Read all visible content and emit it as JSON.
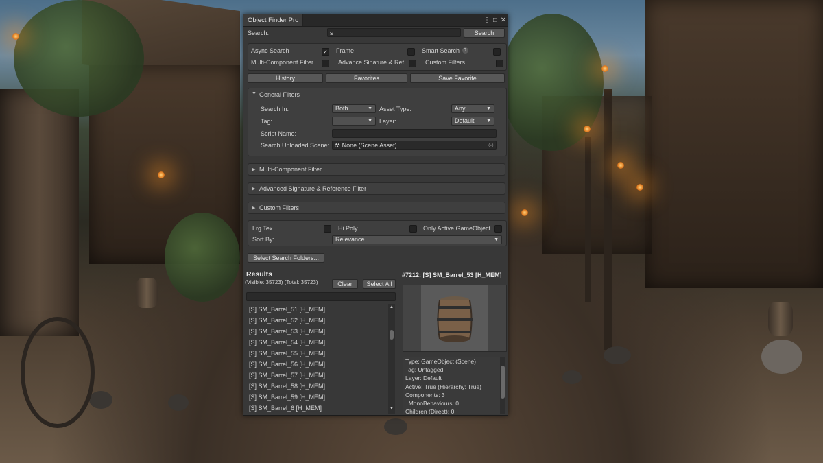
{
  "window": {
    "tab_title": "Object Finder Pro",
    "menu_icon": "kebab-menu-icon",
    "maximize_icon": "maximize-icon",
    "close_icon": "close-icon"
  },
  "search": {
    "label": "Search:",
    "value": "s",
    "button": "Search"
  },
  "options": {
    "async_search": {
      "label": "Async Search",
      "checked": true
    },
    "frame": {
      "label": "Frame",
      "checked": false
    },
    "smart_search": {
      "label": "Smart Search",
      "checked": false,
      "help_icon": "?"
    },
    "multi_component_filter": {
      "label": "Multi-Component Filter",
      "checked": false
    },
    "advance_signature": {
      "label": "Advance Sinature & Ref",
      "checked": false
    },
    "custom_filters": {
      "label": "Custom Filters",
      "checked": false
    }
  },
  "toolbar": {
    "history": "History",
    "favorites": "Favorites",
    "save_favorite": "Save Favorite"
  },
  "general_filters": {
    "title": "General Filters",
    "search_in_label": "Search In:",
    "search_in_value": "Both",
    "asset_type_label": "Asset Type:",
    "asset_type_value": "Any",
    "tag_label": "Tag:",
    "tag_value": "",
    "layer_label": "Layer:",
    "layer_value": "Default",
    "script_name_label": "Script Name:",
    "script_name_value": "",
    "unloaded_scene_label": "Search Unloaded Scene:",
    "unloaded_scene_value": "None (Scene Asset)"
  },
  "foldouts": {
    "multi_component": "Multi-Component Filter",
    "advanced_signature": "Advanced Signature & Reference Filter",
    "custom_filters": "Custom Filters"
  },
  "extra": {
    "lrg_tex": {
      "label": "Lrg Tex",
      "checked": false
    },
    "hi_poly": {
      "label": "Hi Poly",
      "checked": false
    },
    "only_active": {
      "label": "Only Active GameObject",
      "checked": false
    },
    "sort_by_label": "Sort By:",
    "sort_by_value": "Relevance"
  },
  "folders_button": "Select Search Folders...",
  "results": {
    "title": "Results",
    "counts": "(Visible: 35723)  (Total: 35723)",
    "clear": "Clear",
    "select_all": "Select All",
    "filter_value": "",
    "items": [
      "[S] SM_Barrel_51 [H_MEM]",
      "[S] SM_Barrel_52 [H_MEM]",
      "[S] SM_Barrel_53 [H_MEM]",
      "[S] SM_Barrel_54 [H_MEM]",
      "[S] SM_Barrel_55 [H_MEM]",
      "[S] SM_Barrel_56 [H_MEM]",
      "[S] SM_Barrel_57 [H_MEM]",
      "[S] SM_Barrel_58 [H_MEM]",
      "[S] SM_Barrel_59 [H_MEM]",
      "[S] SM_Barrel_6 [H_MEM]"
    ]
  },
  "selected": {
    "title": "#7212: [S] SM_Barrel_53 [H_MEM]",
    "details": [
      "Type: GameObject (Scene)",
      "Tag: Untagged",
      "Layer: Default",
      "Active: True (Hierarchy: True)",
      "Components: 3",
      "  MonoBehaviours: 0",
      "Children (Direct): 0"
    ]
  },
  "colors": {
    "panel_bg": "#383838",
    "button_bg": "#585858",
    "field_bg": "#2a2a2a",
    "text": "#d4d4d4"
  }
}
